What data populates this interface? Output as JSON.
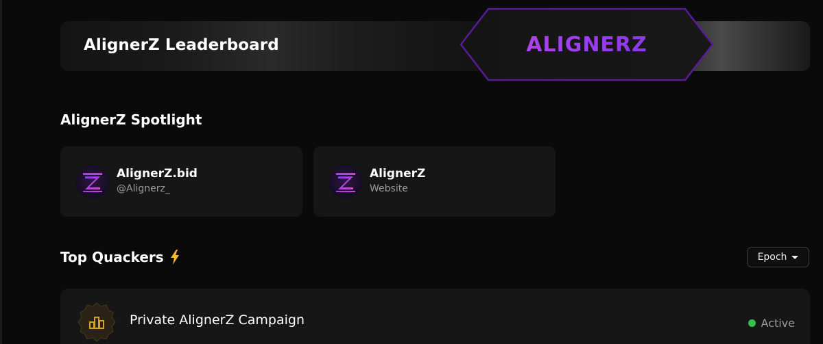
{
  "hero": {
    "title": "AlignerZ Leaderboard",
    "logo_text": "ALIGNERZ",
    "logo_colors": [
      "#c04bd8",
      "#7a35e0"
    ],
    "badge_border_color": "#6a1fb0"
  },
  "spotlight": {
    "title": "AlignerZ Spotlight",
    "cards": [
      {
        "name": "AlignerZ.bid",
        "subtitle": "@Alignerz_",
        "icon": "alignerz-logo-icon"
      },
      {
        "name": "AlignerZ",
        "subtitle": "Website",
        "icon": "alignerz-logo-icon"
      }
    ]
  },
  "top_quackers": {
    "title": "Top Quackers",
    "title_icon": "lightning-icon",
    "title_icon_color": "#f5b82e",
    "filter": {
      "label": "Epoch",
      "icon": "caret-down-icon"
    }
  },
  "campaigns": [
    {
      "title": "Private AlignerZ Campaign",
      "icon": "bar-chart-icon",
      "icon_color": "#d4a12a",
      "status": "Active",
      "status_color": "#35c04a"
    }
  ]
}
